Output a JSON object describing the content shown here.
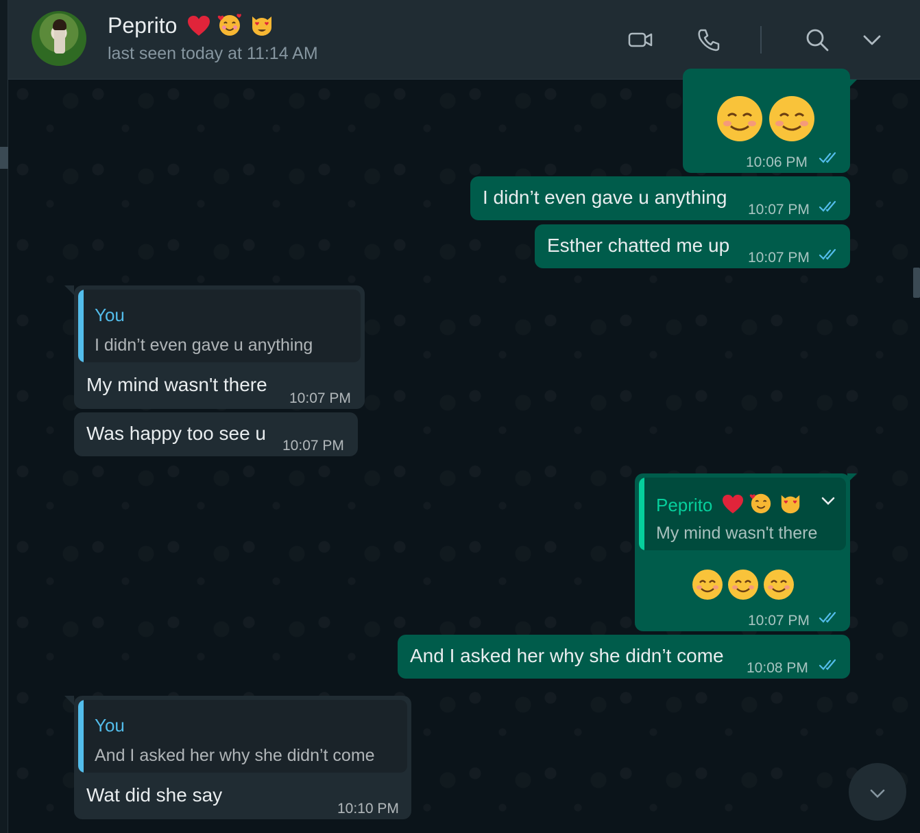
{
  "header": {
    "contact_name": "Peprito",
    "contact_emojis": [
      "red-heart",
      "smiling-face-with-hearts",
      "smiling-cat-heart-eyes"
    ],
    "last_seen": "last seen today at 11:14 AM",
    "icons": [
      "video-call-icon",
      "voice-call-icon",
      "search-icon",
      "chevron-down-icon"
    ]
  },
  "messages": [
    {
      "direction": "out",
      "emojis": [
        "smiling-face",
        "smiling-face"
      ],
      "time": "10:06 PM",
      "status": "read"
    },
    {
      "direction": "out",
      "text": "I didn’t even gave u anything",
      "time": "10:07 PM",
      "status": "read"
    },
    {
      "direction": "out",
      "text": "Esther chatted me up",
      "time": "10:07 PM",
      "status": "read"
    },
    {
      "direction": "in",
      "reply_to": {
        "author": "You",
        "text": "I didn’t even gave u anything"
      },
      "text": "My mind wasn't there",
      "time": "10:07 PM"
    },
    {
      "direction": "in",
      "text": "Was happy too see u",
      "time": "10:07 PM"
    },
    {
      "direction": "out",
      "reply_to": {
        "author": "Peprito",
        "text": "My mind wasn't there"
      },
      "emojis": [
        "smiling-face-smiling-eyes",
        "smiling-face-smiling-eyes",
        "smiling-face-smiling-eyes"
      ],
      "time": "10:07 PM",
      "status": "read"
    },
    {
      "direction": "out",
      "text": "And I asked her why she didn’t come",
      "time": "10:08 PM",
      "status": "read"
    },
    {
      "direction": "in",
      "reply_to": {
        "author": "You",
        "text": "And I asked her why she didn’t come"
      },
      "text": "Wat did she say",
      "time": "10:10 PM"
    }
  ],
  "colors": {
    "outgoing_bubble": "#005c4b",
    "incoming_bubble": "#202c33",
    "read_tick": "#53bdeb",
    "reply_you": "#53bdeb",
    "reply_contact": "#06cf9c"
  }
}
